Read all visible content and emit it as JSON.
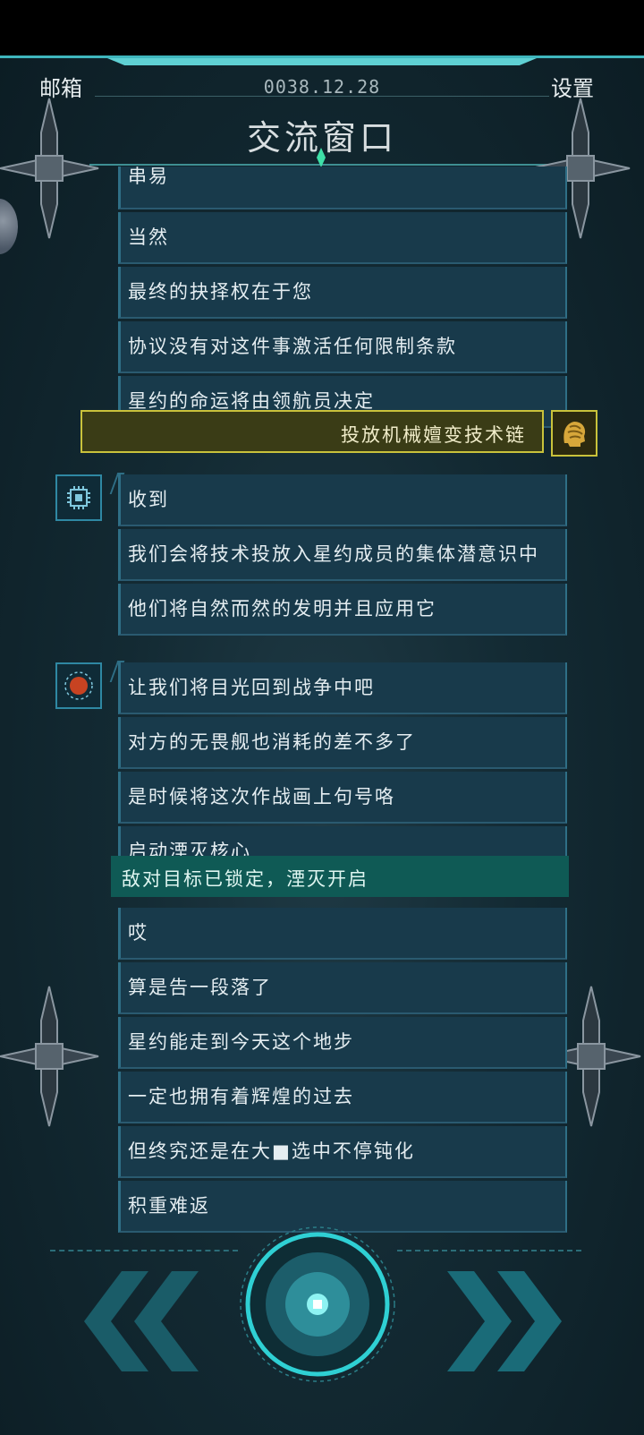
{
  "header": {
    "mailbox_label": "邮箱",
    "date": "0038.12.28",
    "settings_label": "设置",
    "window_title": "交流窗口"
  },
  "chat": {
    "group1": [
      "串易",
      "当然",
      "最终的抉择权在于您",
      "协议没有对这件事激活任何限制条款",
      "星约的命运将由领航员决定"
    ],
    "choice": "投放机械嬗变技术链",
    "group2": [
      "收到",
      "我们会将技术投放入星约成员的集体潜意识中",
      "他们将自然而然的发明并且应用它"
    ],
    "group3": [
      "让我们将目光回到战争中吧",
      "对方的无畏舰也消耗的差不多了",
      "是时候将这次作战画上句号咯",
      "启动湮灭核心"
    ],
    "system": "敌对目标已锁定，湮灭开启",
    "group4": [
      "哎",
      "算是告一段落了",
      "星约能走到今天这个地步",
      "一定也拥有着辉煌的过去",
      "但终究还是在大■选中不停钝化",
      "积重难返"
    ]
  },
  "colors": {
    "panel": "#183a4b",
    "accent": "#3fb6bd",
    "choice_border": "#c9c23b",
    "system_bg": "#0f5a55"
  },
  "icons": {
    "ai_avatar": "ai-chip-icon",
    "enemy_avatar": "red-brain-icon",
    "player_avatar": "brain-head-icon",
    "prev": "double-chevron-left-icon",
    "next": "double-chevron-right-icon",
    "core": "core-button-icon"
  }
}
